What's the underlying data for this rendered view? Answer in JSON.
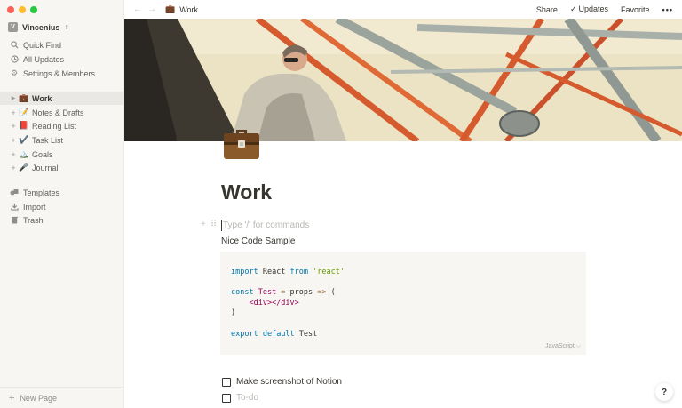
{
  "window": {
    "traffic_colors": [
      "#fe5f57",
      "#febc2e",
      "#28c840"
    ]
  },
  "workspace": {
    "avatar_letter": "V",
    "name": "Vincenius",
    "chevron": "⌃"
  },
  "sidebar": {
    "top_items": [
      {
        "label": "Quick Find",
        "icon": "search-icon"
      },
      {
        "label": "All Updates",
        "icon": "clock-icon"
      },
      {
        "label": "Settings & Members",
        "icon": "gear-icon"
      }
    ],
    "pages": [
      {
        "label": "Work",
        "emoji": "💼",
        "active": true
      },
      {
        "label": "Notes & Drafts",
        "emoji": "📝",
        "active": false
      },
      {
        "label": "Reading List",
        "emoji": "📕",
        "active": false
      },
      {
        "label": "Task List",
        "emoji": "✔️",
        "active": false
      },
      {
        "label": "Goals",
        "emoji": "🏔️",
        "active": false
      },
      {
        "label": "Journal",
        "emoji": "🎤",
        "active": false
      }
    ],
    "bottom_items": [
      {
        "label": "Templates",
        "icon": "templates-icon"
      },
      {
        "label": "Import",
        "icon": "import-icon"
      },
      {
        "label": "Trash",
        "icon": "trash-icon"
      }
    ],
    "new_page": "New Page"
  },
  "topbar": {
    "breadcrumb_emoji": "💼",
    "breadcrumb": "Work",
    "share": "Share",
    "updates": "Updates",
    "favorite": "Favorite",
    "more": "•••"
  },
  "page": {
    "icon": "briefcase-icon",
    "title": "Work",
    "placeholder": "Type '/' for commands",
    "heading_text": "Nice Code Sample",
    "code_language": "JavaScript",
    "todos": [
      {
        "text": "Make screenshot of Notion",
        "checked": false,
        "placeholder": false
      },
      {
        "text": "To-do",
        "checked": false,
        "placeholder": true
      }
    ]
  },
  "code_lines": {
    "l1": {
      "k1": "import",
      "t1": " React ",
      "k2": "from",
      "s1": "'react'"
    },
    "l3": {
      "k1": "const",
      "t1": " Test",
      "o1": " = ",
      "t2": "props",
      "o2": " => ",
      "t3": "("
    },
    "l4": {
      "indent": "    ",
      "tag": "<div></div>"
    },
    "l5": {
      "t1": ")"
    },
    "l7": {
      "k1": "export",
      "k2": "default",
      "t1": " Test"
    }
  },
  "help": "?"
}
